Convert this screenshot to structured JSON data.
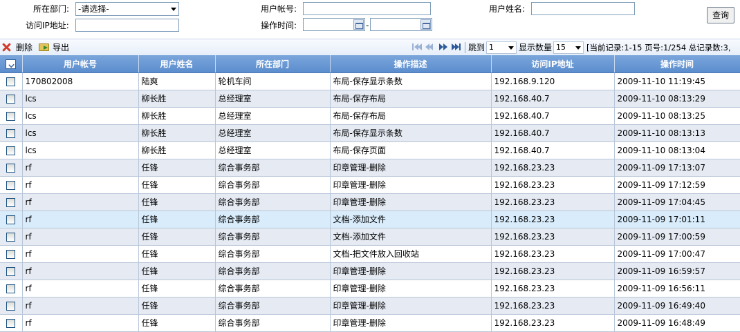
{
  "search": {
    "dept_label": "所在部门:",
    "dept_value": "-请选择-",
    "account_label": "用户帐号:",
    "account_value": "",
    "username_label": "用户姓名:",
    "username_value": "",
    "ip_label": "访问IP地址:",
    "ip_value": "",
    "time_label": "操作时间:",
    "time_start": "",
    "time_sep": "-",
    "time_end": "",
    "query_button": "查询"
  },
  "toolbar": {
    "delete_label": "删除",
    "export_label": "导出",
    "jump_label": "跳到",
    "jump_value": "1",
    "pagesize_label": "显示数量",
    "pagesize_value": "15",
    "record_info": "[当前记录:1-15 页号:1/254 总记录数:3,"
  },
  "columns": [
    "用户帐号",
    "用户姓名",
    "所在部门",
    "操作描述",
    "访问IP地址",
    "操作时间"
  ],
  "rows": [
    [
      "170802008",
      "陆爽",
      "轮机车间",
      "布局-保存显示条数",
      "192.168.9.120",
      "2009-11-10 11:19:45"
    ],
    [
      "lcs",
      "柳长胜",
      "总经理室",
      "布局-保存布局",
      "192.168.40.7",
      "2009-11-10 08:13:29"
    ],
    [
      "lcs",
      "柳长胜",
      "总经理室",
      "布局-保存布局",
      "192.168.40.7",
      "2009-11-10 08:13:25"
    ],
    [
      "lcs",
      "柳长胜",
      "总经理室",
      "布局-保存显示条数",
      "192.168.40.7",
      "2009-11-10 08:13:13"
    ],
    [
      "lcs",
      "柳长胜",
      "总经理室",
      "布局-保存页面",
      "192.168.40.7",
      "2009-11-10 08:13:04"
    ],
    [
      "rf",
      "任锋",
      "综合事务部",
      "印章管理-删除",
      "192.168.23.23",
      "2009-11-09 17:13:07"
    ],
    [
      "rf",
      "任锋",
      "综合事务部",
      "印章管理-删除",
      "192.168.23.23",
      "2009-11-09 17:12:59"
    ],
    [
      "rf",
      "任锋",
      "综合事务部",
      "印章管理-删除",
      "192.168.23.23",
      "2009-11-09 17:04:45"
    ],
    [
      "rf",
      "任锋",
      "综合事务部",
      "文档-添加文件",
      "192.168.23.23",
      "2009-11-09 17:01:11"
    ],
    [
      "rf",
      "任锋",
      "综合事务部",
      "文档-添加文件",
      "192.168.23.23",
      "2009-11-09 17:00:59"
    ],
    [
      "rf",
      "任锋",
      "综合事务部",
      "文档-把文件放入回收站",
      "192.168.23.23",
      "2009-11-09 17:00:47"
    ],
    [
      "rf",
      "任锋",
      "综合事务部",
      "印章管理-删除",
      "192.168.23.23",
      "2009-11-09 16:59:57"
    ],
    [
      "rf",
      "任锋",
      "综合事务部",
      "印章管理-删除",
      "192.168.23.23",
      "2009-11-09 16:56:11"
    ],
    [
      "rf",
      "任锋",
      "综合事务部",
      "印章管理-删除",
      "192.168.23.23",
      "2009-11-09 16:49:40"
    ],
    [
      "rf",
      "任锋",
      "综合事务部",
      "印章管理-删除",
      "192.168.23.23",
      "2009-11-09 16:48:49"
    ]
  ],
  "colors": {
    "header_blue": "#6a9ad4",
    "row_alt": "#e5eaf3",
    "row_highlight": "#d8ecfb",
    "delete_red": "#d23a2a",
    "nav_blue": "#2d5a9a"
  },
  "icons": {
    "delete": "delete-x-icon",
    "export": "export-folder-icon",
    "first": "first-page-icon",
    "prev": "prev-page-icon",
    "next": "next-page-icon",
    "last": "last-page-icon",
    "calendar": "calendar-icon",
    "select_all": "select-all-icon"
  }
}
